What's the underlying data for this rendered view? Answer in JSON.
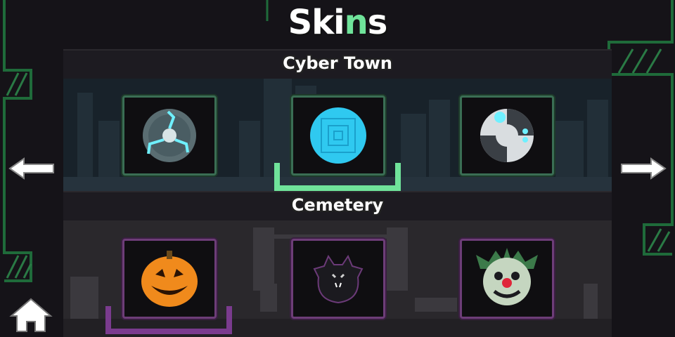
{
  "header": {
    "title_pre": "Ski",
    "title_accent": "n",
    "title_post": "s"
  },
  "sections": [
    {
      "title": "Cyber Town",
      "accent": "#6fe39a",
      "skins": [
        {
          "icon": "electric-orb-icon",
          "selected": false
        },
        {
          "icon": "pixel-ball-icon",
          "selected": true
        },
        {
          "icon": "robot-ball-icon",
          "selected": false
        }
      ]
    },
    {
      "title": "Cemetery",
      "accent": "#7a3b8e",
      "skins": [
        {
          "icon": "pumpkin-icon",
          "selected": true
        },
        {
          "icon": "bat-icon",
          "selected": false
        },
        {
          "icon": "clown-icon",
          "selected": false
        }
      ]
    }
  ],
  "nav": {
    "prev": "arrow-left-icon",
    "next": "arrow-right-icon",
    "home": "home-icon"
  }
}
